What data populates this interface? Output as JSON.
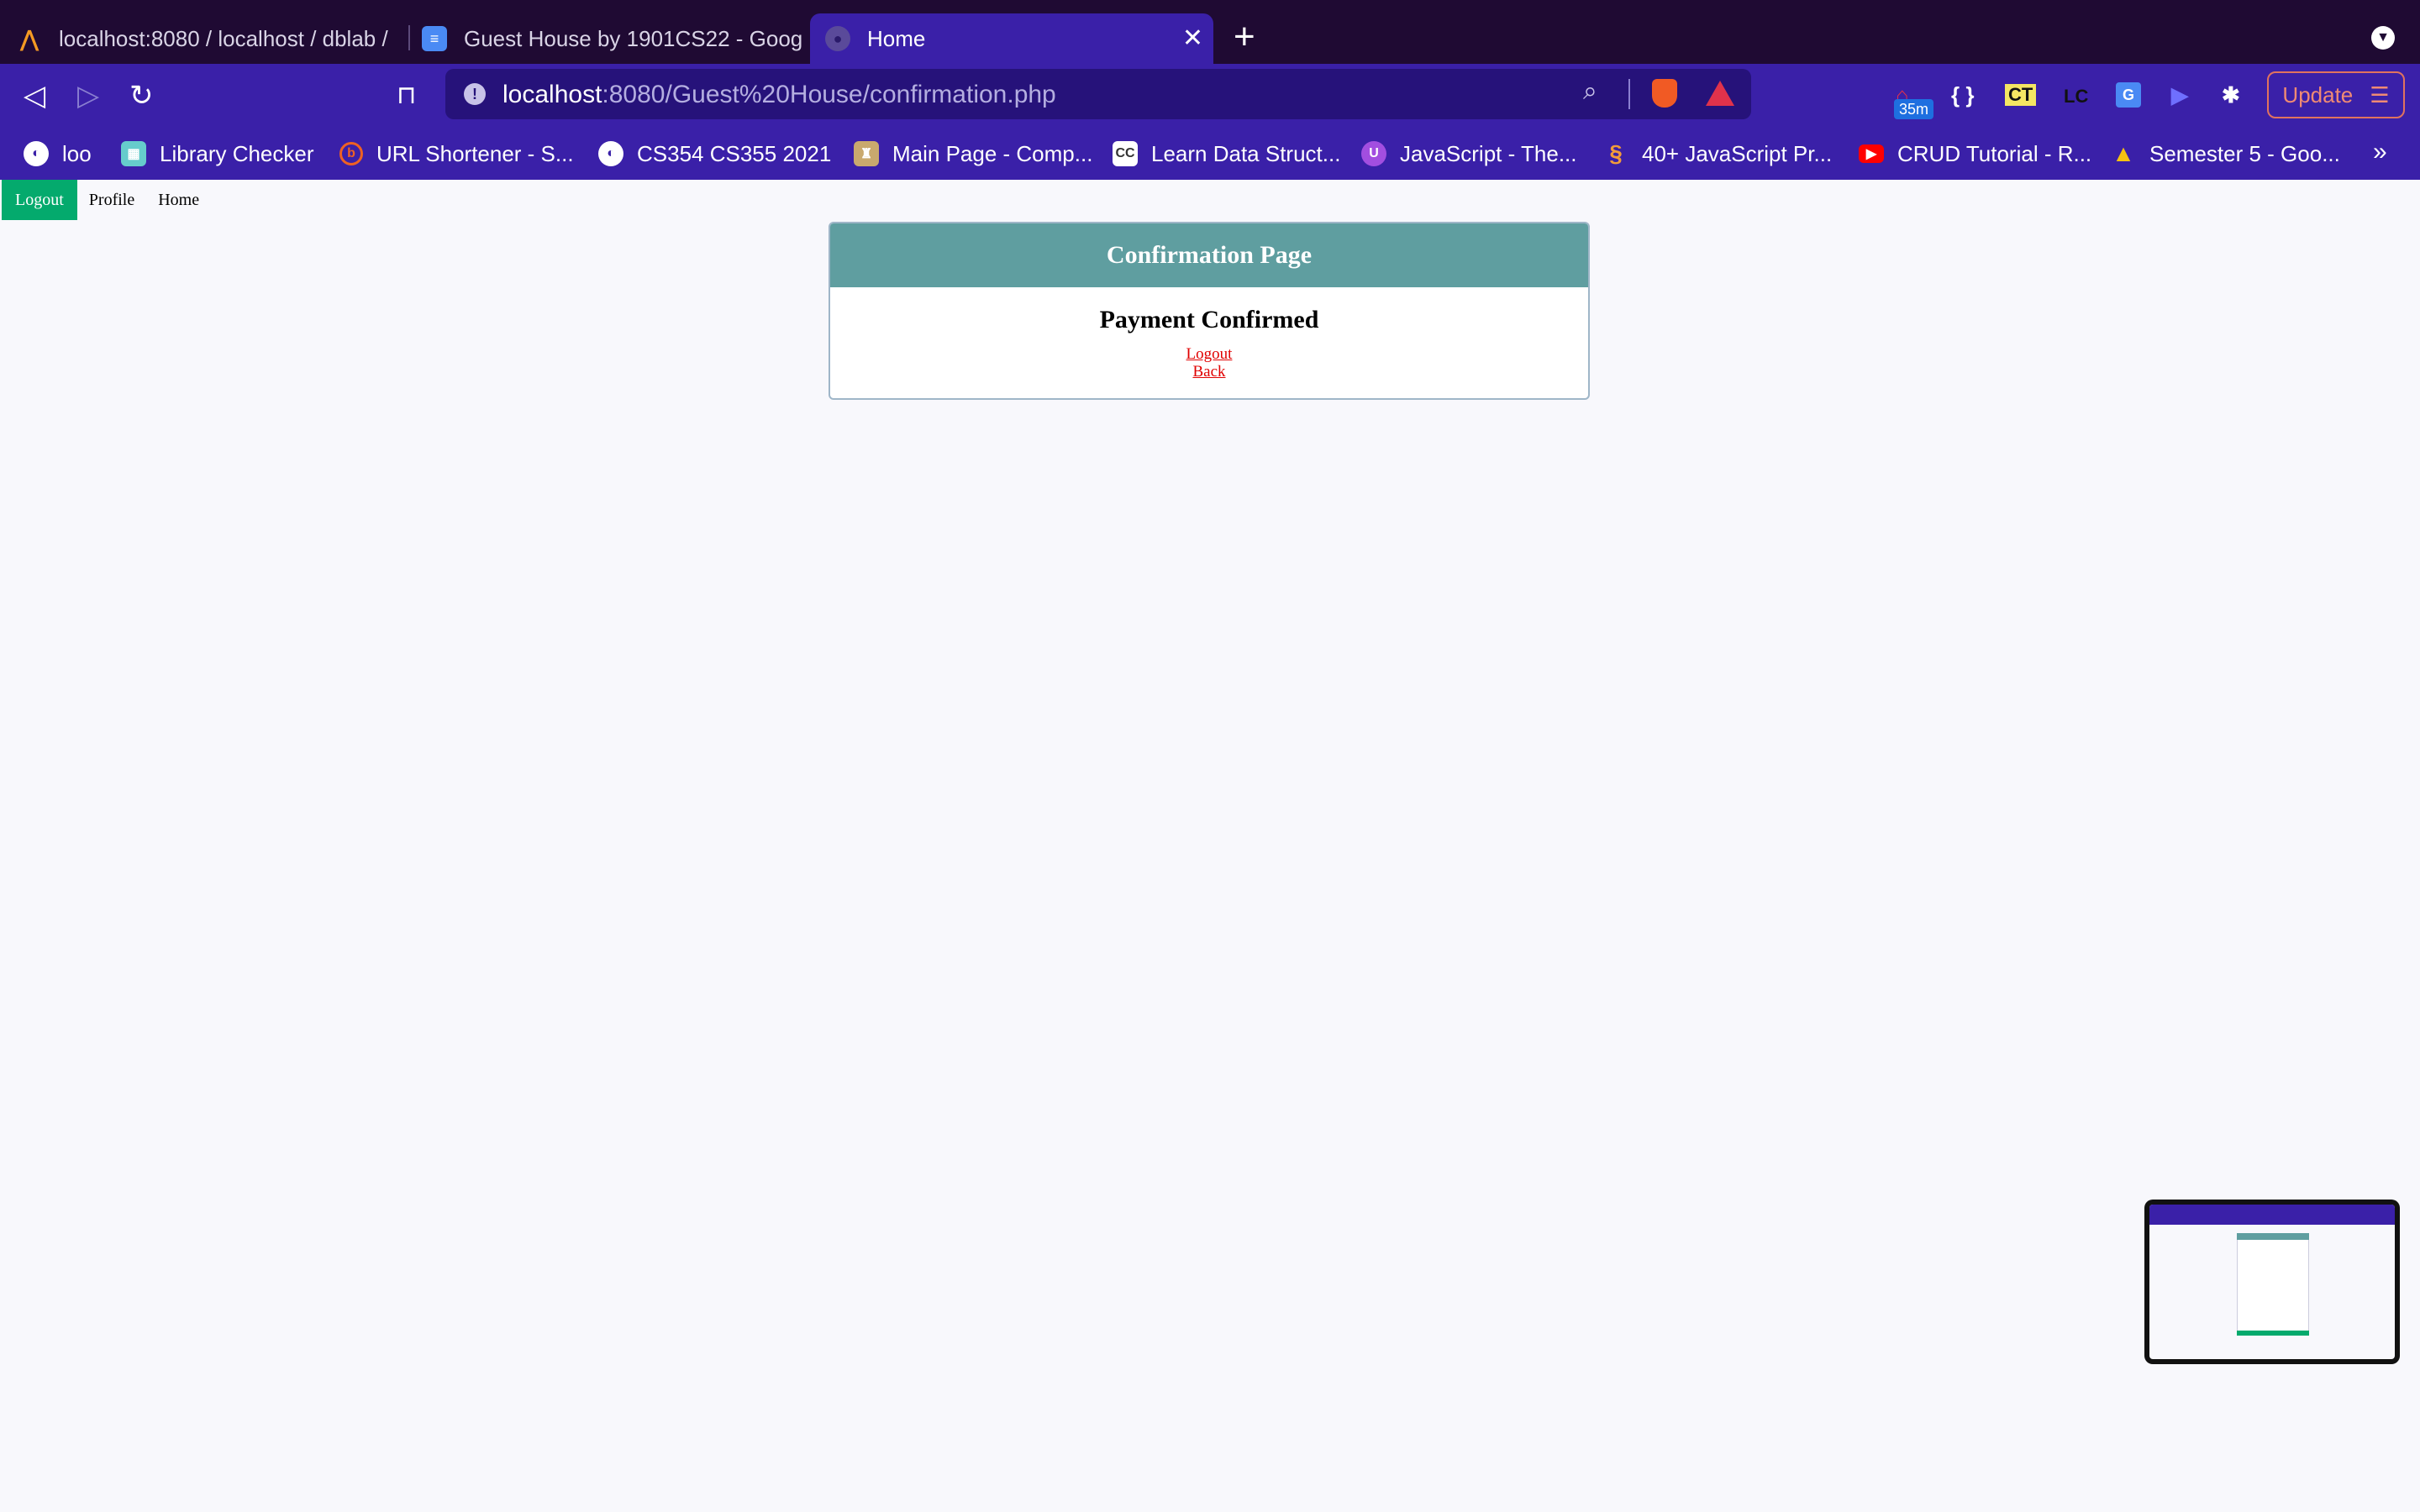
{
  "browser": {
    "tabs": [
      {
        "label": "localhost:8080 / localhost / dblab /",
        "icon": "phpmyadmin-icon"
      },
      {
        "label": "Guest House by 1901CS22 - Google Docs",
        "icon": "google-docs-icon"
      },
      {
        "label": "Home",
        "icon": "globe-icon",
        "active": true
      }
    ],
    "url": {
      "host": "localhost",
      "rest": ":8080/Guest%20House/confirmation.php"
    },
    "extension_badge": "35m",
    "update_label": "Update",
    "bookmarks": [
      {
        "label": "loo",
        "icon": "globe-icon"
      },
      {
        "label": "Library Checker",
        "icon": "library-checker-icon"
      },
      {
        "label": "URL Shortener - S...",
        "icon": "bitly-icon"
      },
      {
        "label": "CS354 CS355 2021",
        "icon": "globe-icon"
      },
      {
        "label": "Main Page - Comp...",
        "icon": "wiki-icon"
      },
      {
        "label": "Learn Data Struct...",
        "icon": "cc-icon"
      },
      {
        "label": "JavaScript - The...",
        "icon": "mdn-icon"
      },
      {
        "label": "40+ JavaScript Pr...",
        "icon": "swirl-icon"
      },
      {
        "label": "CRUD Tutorial - R...",
        "icon": "youtube-icon"
      },
      {
        "label": "Semester 5 - Goo...",
        "icon": "google-drive-icon"
      }
    ]
  },
  "page": {
    "nav": [
      "Logout",
      "Profile",
      "Home"
    ],
    "card": {
      "header": "Confirmation Page",
      "title": "Payment Confirmed",
      "links": [
        "Logout",
        "Back"
      ]
    }
  },
  "colors": {
    "tabbar": "#1f0a33",
    "toolbar": "#3a20a8",
    "nav_active": "#04aa6d",
    "card_header": "#5f9ea0",
    "link": "#e00000"
  }
}
